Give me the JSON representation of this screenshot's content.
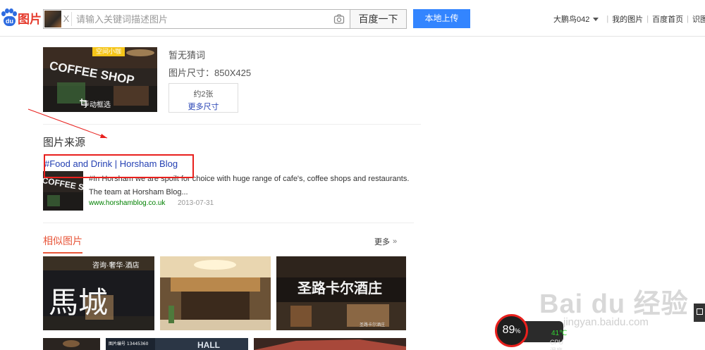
{
  "header": {
    "logo_badge": "du",
    "logo_text": "图片",
    "search_placeholder": "请输入关键词描述图片",
    "clear_label": "X",
    "search_button": "百度一下",
    "upload_button": "本地上传",
    "user_name": "大鹏鸟042",
    "nav_links": [
      "我的图片",
      "百度首页",
      "识图插件"
    ]
  },
  "query": {
    "tag": "空间小咖",
    "crop_label": "手动框选",
    "guess": "暂无猜词",
    "size_label": "图片尺寸：850X425",
    "count": "约2张",
    "more_sizes": "更多尺寸",
    "sign_text": "COFFEE SHOP"
  },
  "source": {
    "title": "图片来源",
    "link": "#Food and Drink | Horsham Blog",
    "description_line1": "#In Horsham we are spoilt for choice with huge range of cafe's, coffee shops and restaurants.",
    "description_line2": "The team at Horsham Blog...",
    "url": "www.horshamblog.co.uk",
    "date": "2013-07-31"
  },
  "similar": {
    "title": "相似图片",
    "more": "更多",
    "thumb1_text": "馬城",
    "thumb1_sign": "咨询·奢华·酒店",
    "thumb3_sign": "圣路卡尔酒庄",
    "thumb3_caption": "圣路卡尔酒庄",
    "row2_caption": "图片编号 13445360",
    "row2_sign": "HALL"
  },
  "watermark": {
    "text": "Bai du 经验",
    "url": "jingyan.baidu.com"
  },
  "cpu": {
    "percent": "89",
    "percent_unit": "%",
    "temp": "41℃",
    "label": "CPU温度"
  },
  "colors": {
    "accent": "#3385ff",
    "link": "#2440b3",
    "similar_accent": "#e8563a",
    "annotation": "#e8201d",
    "url_green": "#008000"
  },
  "icons": [
    "paw-icon",
    "camera-icon",
    "crop-icon",
    "chevron-double-right-icon",
    "caret-down-icon",
    "external-icon"
  ]
}
